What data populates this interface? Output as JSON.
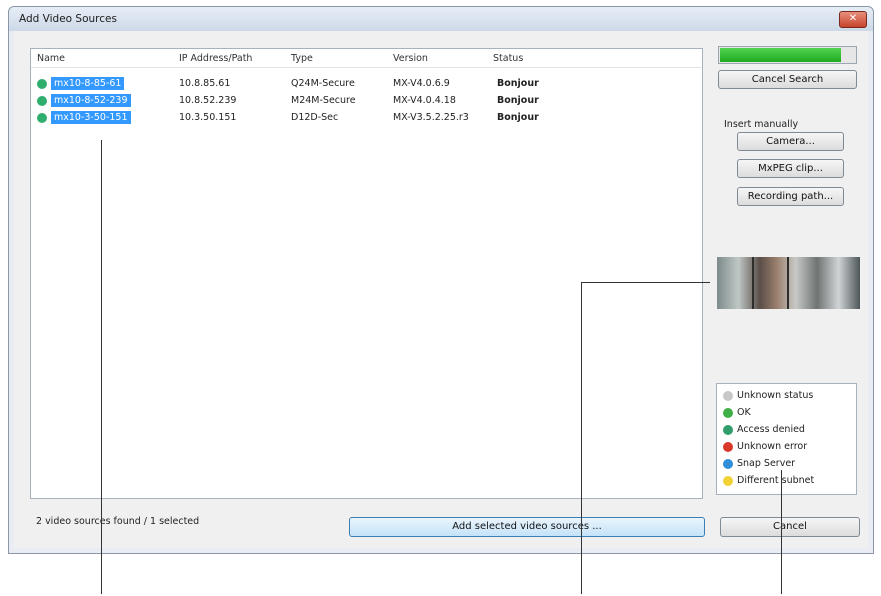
{
  "window": {
    "title": "Add Video Sources",
    "close_icon": "close-icon"
  },
  "table": {
    "columns": [
      "Name",
      "IP Address/Path",
      "Type",
      "Version",
      "Status"
    ],
    "rows": [
      {
        "name": "mx10-8-85-61",
        "ip": "10.8.85.61",
        "type": "Q24M-Secure",
        "version": "MX-V4.0.6.9",
        "status": "Bonjour",
        "status_color": "#2fae6e"
      },
      {
        "name": "mx10-8-52-239",
        "ip": "10.8.52.239",
        "type": "M24M-Secure",
        "version": "MX-V4.0.4.18",
        "status": "Bonjour",
        "status_color": "#2fae6e"
      },
      {
        "name": "mx10-3-50-151",
        "ip": "10.3.50.151",
        "type": "D12D-Sec",
        "version": "MX-V3.5.2.25.r3",
        "status": "Bonjour",
        "status_color": "#2fae6e"
      }
    ]
  },
  "footer": {
    "status": "2 video sources found / 1 selected",
    "add_button": "Add selected video sources ...",
    "cancel_button": "Cancel"
  },
  "sidebar": {
    "progress": 0.88,
    "cancel_search": "Cancel Search",
    "insert_manually": "Insert manually",
    "camera_button": "Camera...",
    "mxpeg_button": "MxPEG clip...",
    "recording_button": "Recording path..."
  },
  "legend": [
    {
      "label": "Unknown status",
      "color": "#c8c8c8"
    },
    {
      "label": "OK",
      "color": "#3fae49"
    },
    {
      "label": "Access denied",
      "color": "#2f9e6b"
    },
    {
      "label": "Unknown error",
      "color": "#d9392b"
    },
    {
      "label": "Snap Server",
      "color": "#2f8fd8"
    },
    {
      "label": "Different subnet",
      "color": "#f2d132"
    }
  ]
}
